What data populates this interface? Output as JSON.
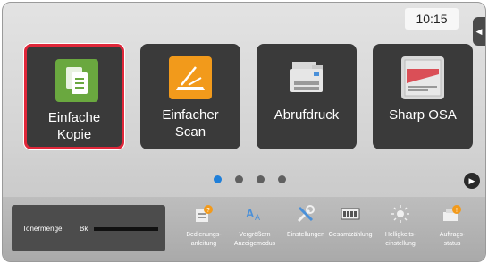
{
  "clock": {
    "time": "10:15"
  },
  "tiles": [
    {
      "label": "Einfache\nKopie",
      "icon": "copy-icon",
      "color": "#6aa83f"
    },
    {
      "label": "Einfacher\nScan",
      "icon": "scan-icon",
      "color": "#f29a1b"
    },
    {
      "label": "Abrufdruck",
      "icon": "printer-icon",
      "color": "#3a3a3a"
    },
    {
      "label": "Sharp OSA",
      "icon": "osa-icon",
      "color": "#d9d9d9"
    }
  ],
  "pager": {
    "pages": 4,
    "current": 1
  },
  "toner": {
    "label": "Tonermenge",
    "color_label": "Bk",
    "level": 1.0
  },
  "softkeys": [
    {
      "label": "Bedienungs-\nanleitung",
      "icon": "manual-icon"
    },
    {
      "label": "Vergrößern\nAnzeigemodus",
      "icon": "zoom-text-icon"
    },
    {
      "label": "Einstellungen",
      "icon": "settings-icon"
    },
    {
      "label": "Gesamtzählung",
      "icon": "counter-icon"
    },
    {
      "label": "Helligkeits-\neinstellung",
      "icon": "brightness-icon"
    },
    {
      "label": "Auftrags-\nstatus",
      "icon": "job-status-icon"
    }
  ],
  "colors": {
    "selected_border": "#e0273a",
    "tile_bg": "#3a3a3a",
    "active_dot": "#1f7fd9"
  }
}
